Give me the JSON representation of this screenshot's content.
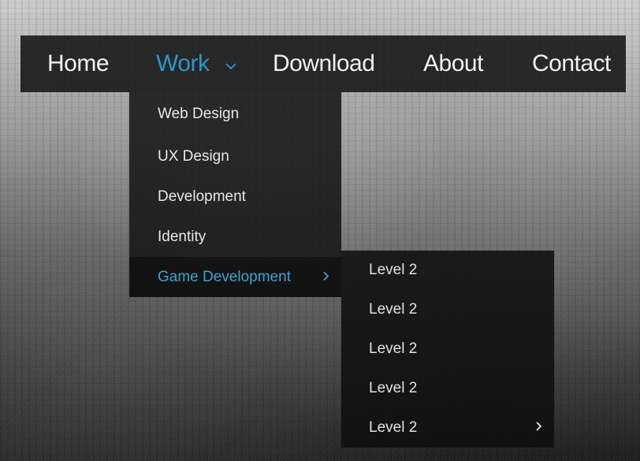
{
  "colors": {
    "accent": "#2f97c6",
    "text": "#f2f2f2",
    "bar_bg": "#141414"
  },
  "nav": {
    "items": [
      {
        "label": "Home",
        "active": false
      },
      {
        "label": "Work",
        "active": true,
        "icon": "chevron-down-icon"
      },
      {
        "label": "Download",
        "active": false
      },
      {
        "label": "About",
        "active": false
      },
      {
        "label": "Contact",
        "active": false
      }
    ]
  },
  "dropdown": {
    "items": [
      {
        "label": "Web Design"
      },
      {
        "label": "UX Design"
      },
      {
        "label": "Development"
      },
      {
        "label": "Identity"
      },
      {
        "label": "Game Development",
        "active": true,
        "icon": "chevron-right-icon"
      }
    ]
  },
  "submenu": {
    "items": [
      {
        "label": "Level 2"
      },
      {
        "label": "Level 2"
      },
      {
        "label": "Level 2"
      },
      {
        "label": "Level 2"
      },
      {
        "label": "Level 2",
        "icon": "chevron-right-icon"
      }
    ]
  }
}
